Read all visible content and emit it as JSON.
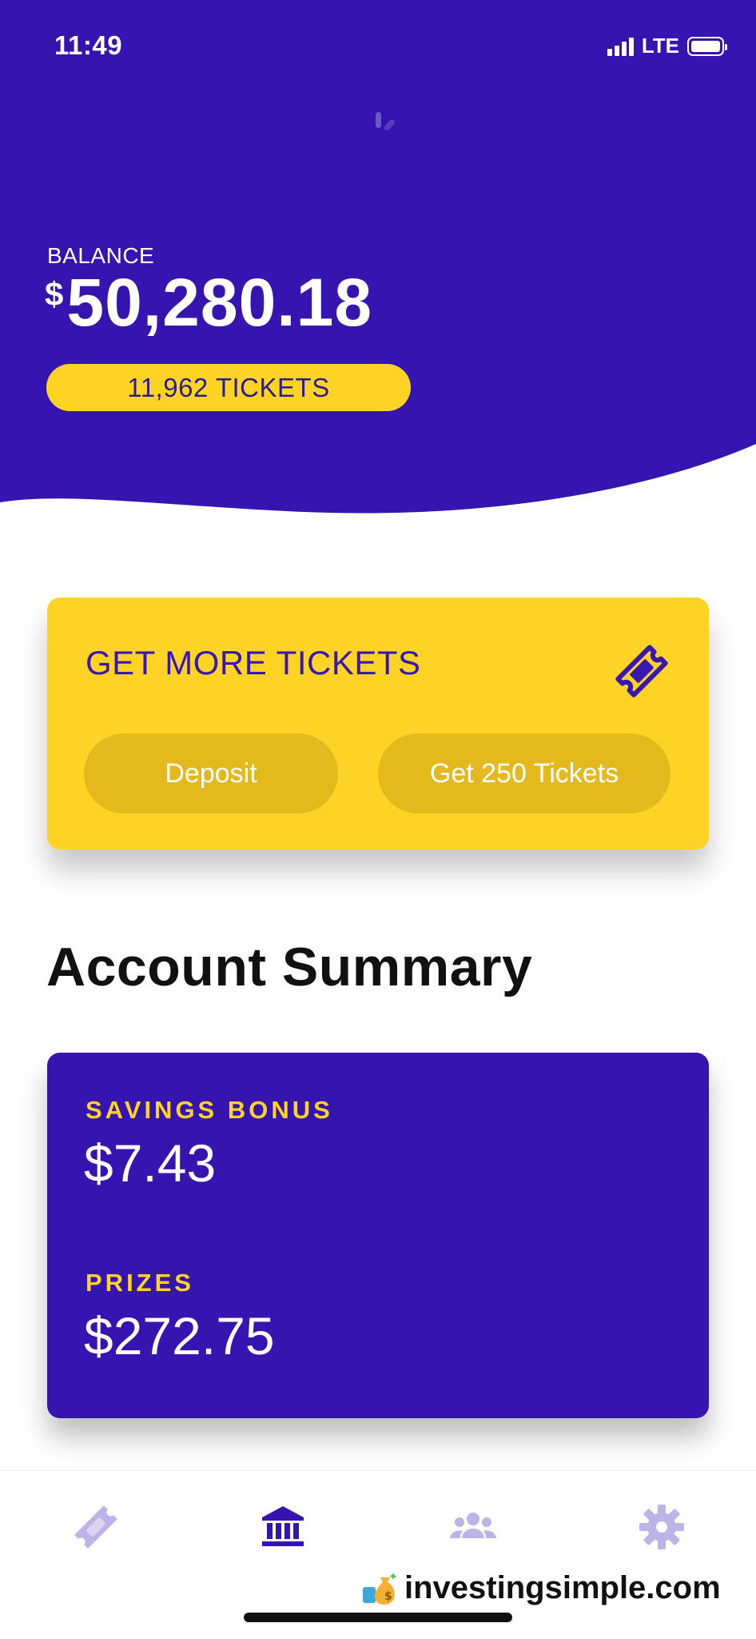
{
  "status_bar": {
    "time": "11:49",
    "network": "LTE"
  },
  "hero": {
    "balance_label": "BALANCE",
    "balance_currency": "$",
    "balance_amount": "50,280.18",
    "tickets": "11,962 TICKETS",
    "bg_color": "#3614B0"
  },
  "get_more_card": {
    "title": "GET MORE TICKETS",
    "deposit_label": "Deposit",
    "get_tickets_label": "Get 250 Tickets",
    "icon": "ticket-icon",
    "bg_color": "#FDD426"
  },
  "account_summary": {
    "title": "Account Summary",
    "savings_bonus_label": "SAVINGS BONUS",
    "savings_bonus_value": "$7.43",
    "prizes_label": "PRIZES",
    "prizes_value": "$272.75"
  },
  "tab_bar": {
    "items": [
      {
        "icon": "ticket-icon",
        "active": false
      },
      {
        "icon": "bank-icon",
        "active": true
      },
      {
        "icon": "people-icon",
        "active": false
      },
      {
        "icon": "gear-icon",
        "active": false
      }
    ]
  },
  "watermark": {
    "text": "investingsimple.com"
  }
}
